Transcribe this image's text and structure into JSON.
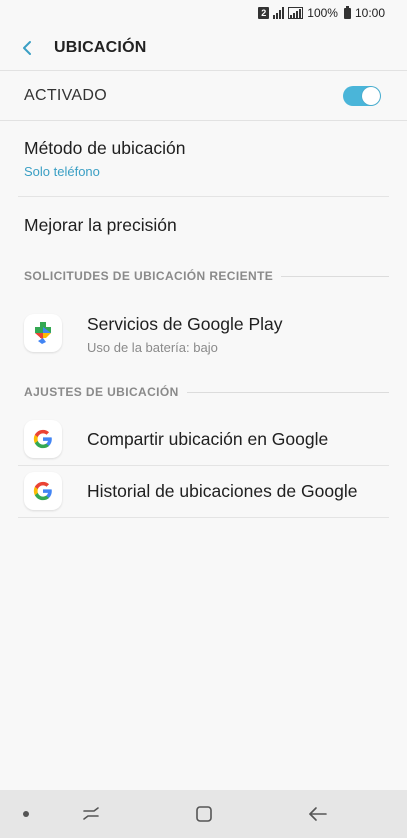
{
  "status_bar": {
    "sim_slot": "2",
    "battery_percent": "100%",
    "time": "10:00"
  },
  "header": {
    "title": "UBICACIÓN",
    "back_icon": "chevron-left-icon"
  },
  "master_switch": {
    "label": "ACTIVADO",
    "state": "on",
    "accent_color": "#4ab5d9"
  },
  "settings": [
    {
      "title": "Método de ubicación",
      "subtitle": "Solo teléfono"
    },
    {
      "title": "Mejorar la precisión"
    }
  ],
  "recent_requests": {
    "header": "SOLICITUDES DE UBICACIÓN RECIENTE",
    "items": [
      {
        "title": "Servicios de Google Play",
        "subtitle": "Uso de la batería: bajo",
        "icon": "google-play-services-icon"
      }
    ]
  },
  "location_settings": {
    "header": "AJUSTES DE UBICACIÓN",
    "items": [
      {
        "title": "Compartir ubicación en Google",
        "icon": "google-g-icon"
      },
      {
        "title": "Historial de ubicaciones de Google",
        "icon": "google-g-icon"
      }
    ]
  },
  "nav_bar": {
    "items": [
      "dot-indicator-icon",
      "recent-apps-icon",
      "home-icon",
      "back-arrow-icon"
    ]
  }
}
